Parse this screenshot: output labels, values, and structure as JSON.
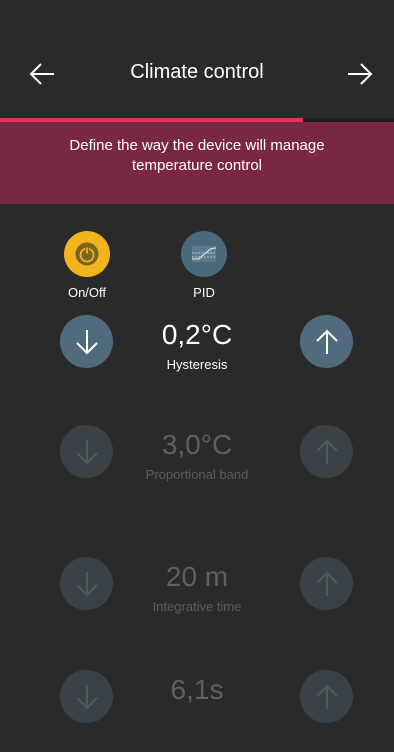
{
  "header": {
    "title": "Climate control"
  },
  "progress": {
    "fraction": 0.77
  },
  "banner": {
    "text": "Define the way the device will manage temperature control"
  },
  "modes": [
    {
      "label": "On/Off",
      "icon": "power-icon",
      "selected": true
    },
    {
      "label": "PID",
      "icon": "pid-curve-icon",
      "selected": false
    }
  ],
  "params": [
    {
      "value": "0,2°C",
      "label": "Hysteresis",
      "enabled": true
    },
    {
      "value": "3,0°C",
      "label": "Proportional band",
      "enabled": false
    },
    {
      "value": "20 m",
      "label": "Integrative time",
      "enabled": false
    },
    {
      "value": "6,1s",
      "label": "",
      "enabled": false
    }
  ],
  "colors": {
    "background": "#2a2a2b",
    "accent": "#e0345f",
    "banner": "#7a2745",
    "selected_mode": "#f2b41c",
    "button": "#4f6b7c"
  }
}
